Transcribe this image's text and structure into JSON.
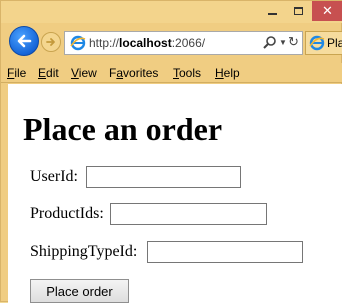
{
  "window": {
    "minimize_label": "",
    "maximize_label": "",
    "close_label": "✕"
  },
  "navigation": {
    "back_icon": "back-arrow-icon",
    "forward_icon": "forward-arrow-icon",
    "address": {
      "prefix": "http://",
      "host": "localhost",
      "rest": ":2066/"
    },
    "tab_title": "Pla"
  },
  "menu": {
    "items": [
      {
        "label": "File",
        "accel": "F"
      },
      {
        "label": "Edit",
        "accel": "E"
      },
      {
        "label": "View",
        "accel": "V"
      },
      {
        "label": "Favorites",
        "accel": "a"
      },
      {
        "label": "Tools",
        "accel": "T"
      },
      {
        "label": "Help",
        "accel": "H"
      }
    ]
  },
  "page": {
    "heading": "Place an order",
    "fields": [
      {
        "label": "UserId:",
        "value": ""
      },
      {
        "label": "ProductIds:",
        "value": ""
      },
      {
        "label": "ShippingTypeId:",
        "value": ""
      }
    ],
    "submit_label": "Place order"
  },
  "colors": {
    "chrome": "#f0cd82",
    "back_button": "#1565d8",
    "close_button": "#c75050"
  }
}
